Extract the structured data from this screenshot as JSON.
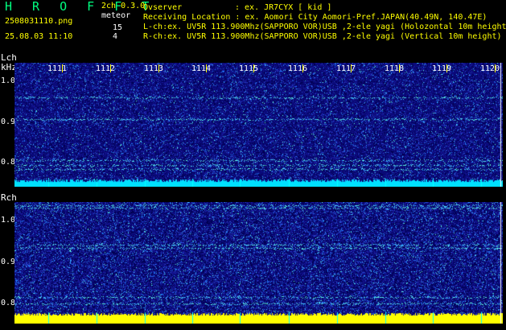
{
  "header": {
    "app_title": "H R O F F T",
    "filename": "2508031110.png",
    "datetime": "25.08.03 11:10",
    "mode": "2ch 0.3.0",
    "meteor_label": "meteor",
    "lch_count": "15",
    "rch_count": "4",
    "observer_label": "Ovserver",
    "observer_value": ": ex. JR7CYX [ kid ]",
    "location_line": "Receiving Location : ex. Aomori City Aomori-Pref.JAPAN(40.49N, 140.47E)",
    "lch_line": "L-ch:ex. UV5R 113.900Mhz(SAPPORO VOR)USB ,2-ele yagi (Holozontal 10m height)",
    "rch_line": "R-ch:ex. UV5R 113.900Mhz(SAPPORO VOR)USB ,2-ele yagi (Vertical 10m height)"
  },
  "lch_panel": {
    "channel_label": "Lch",
    "unit_label": "kHz",
    "y_ticks": [
      "1.0",
      "0.9",
      "0.8"
    ],
    "time_ticks": [
      "1111",
      "1112",
      "1113",
      "1114",
      "1115",
      "1116",
      "1117",
      "1118",
      "1119",
      "1120"
    ]
  },
  "rch_panel": {
    "channel_label": "Rch",
    "y_ticks": [
      "1.0",
      "0.9",
      "0.8"
    ]
  },
  "colors": {
    "background": "#000000",
    "header_text": "#ffff00",
    "title_text": "#00ff80",
    "tick_mark": "#ffff00",
    "noise_floor": "#00e0ff",
    "strong_noise": "#ffff00"
  }
}
